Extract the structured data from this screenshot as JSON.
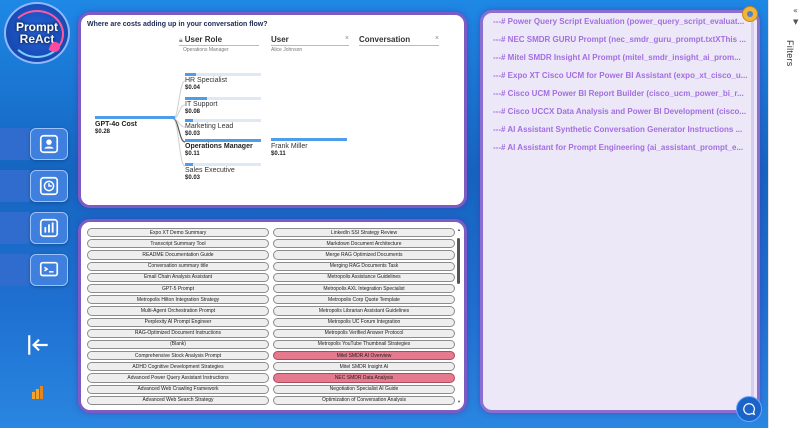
{
  "logo": {
    "line1": "Prompt",
    "line2": "ReAct"
  },
  "sidebar": {
    "nav": [
      {
        "name": "user-nav-button",
        "icon": "user-icon"
      },
      {
        "name": "history-nav-button",
        "icon": "clock-icon"
      },
      {
        "name": "analytics-nav-button",
        "icon": "bar-chart-icon"
      },
      {
        "name": "prompt-nav-button",
        "icon": "terminal-icon"
      }
    ],
    "exit_icon": "exit-icon",
    "brand_icon": "power-bi-icon"
  },
  "decomposition": {
    "question": "Where are costs adding up in your conversation flow?",
    "headers": [
      {
        "label": "User Role",
        "sub": "Operations Manager"
      },
      {
        "label": "User",
        "sub": "Alice Johnson"
      },
      {
        "label": "Conversation",
        "sub": ""
      }
    ],
    "root": {
      "label": "GPT-4o Cost",
      "value": "$0.28"
    },
    "roles": [
      {
        "label": "HR Specialist",
        "value": "$0.04",
        "fill": 0.14
      },
      {
        "label": "IT Support",
        "value": "$0.08",
        "fill": 0.29
      },
      {
        "label": "Marketing Lead",
        "value": "$0.03",
        "fill": 0.11
      },
      {
        "label": "Operations Manager",
        "value": "$0.11",
        "fill": 1.0,
        "selected": true
      },
      {
        "label": "Sales Executive",
        "value": "$0.03",
        "fill": 0.11
      }
    ],
    "user": {
      "label": "Frank Miller",
      "value": "$0.11",
      "fill": 1.0
    }
  },
  "prompt_list": {
    "left": [
      "Expo XT Demo Summary",
      "Transcript Summary Tool",
      "README Documentation Guide",
      "Conversation summary title",
      "Email Chain Analysis Assistant",
      "GPT-5 Prompt",
      "Metropolis Hilton Integration Strategy",
      "Multi-Agent Orchestration Prompt",
      "Perplexity AI Prompt Engineer",
      "RAG-Optimized Document Instructions",
      "(Blank)",
      "Comprehensive Stock Analysis Prompt",
      "ADHD Cognitive Development Strategies",
      "Advanced Power Query Assistant Instructions",
      "Advanced Web Crawling Framework",
      "Advanced Web Search Strategy"
    ],
    "right": [
      "LinkedIn SSI Strategy Review",
      "Markdown Document Architecture",
      "Merge RAG Optimized Documents",
      "Merging RAG Documents Task",
      "Metropolis Assistance Guidelines",
      "Metropolis AXL Integration Specialist",
      "Metropolis Corp Quote Template",
      "Metropolis Librarian Assistant Guidelines",
      "Metropolis UC Forum Integration",
      "Metropolis Verified Answer Protocol",
      "Metropolis YouTube Thumbnail Strategies",
      "Mitel SMDR AI Overview",
      "Mitel SMDR Insight AI",
      "NEC SMDR Data Analysis",
      "Negotiation Specialist AI Guide",
      "Optimization of Conversation Analysis"
    ],
    "selected_right": [
      11,
      13
    ]
  },
  "prompt_files": [
    "---# Power Query Script Evaluation (power_query_script_evaluat...",
    "---# NEC SMDR GURU Prompt (nec_smdr_guru_prompt.txtXThis ...",
    "---# Mitel SMDR Insight AI Prompt (mitel_smdr_insight_ai_prom...",
    "---# Expo XT Cisco UCM for Power BI Assistant (expo_xt_cisco_u...",
    "---# Cisco UCM Power BI Report Builder (cisco_ucm_power_bi_r...",
    "---# Cisco UCCX Data Analysis and Power BI Development (cisco...",
    "---# AI Assistant Synthetic Conversation Generator Instructions ...",
    "---# AI Assistant for Prompt Engineering (ai_assistant_prompt_e..."
  ],
  "filters_pane": {
    "label": "Filters",
    "collapse_glyph": "«",
    "funnel_glyph": "▼"
  },
  "colors": {
    "canvas": "#1565c0",
    "panel_border": "#7b5cc2",
    "bar": "#4d9de8",
    "selected_item": "#e57a8e",
    "prompt_text": "#a36fe0"
  }
}
